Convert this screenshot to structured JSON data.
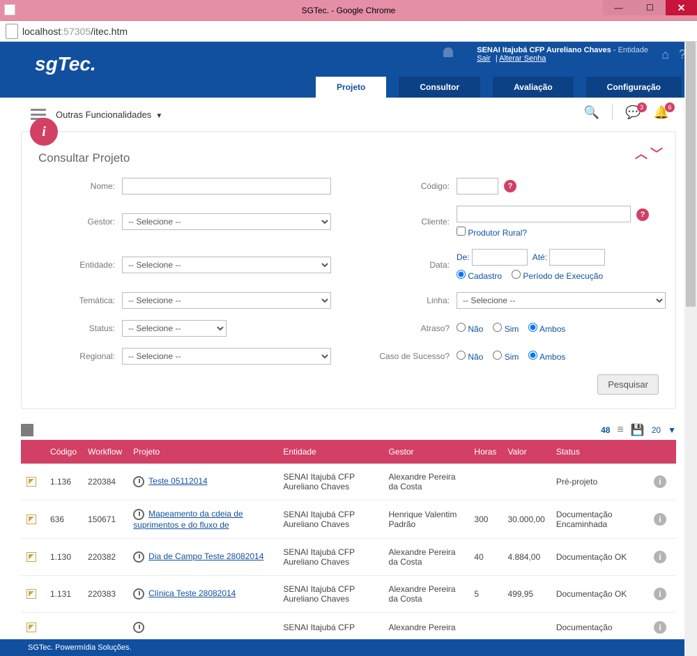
{
  "window": {
    "title": "SGTec. - Google Chrome"
  },
  "address": {
    "host": "localhost",
    "port": ":57305",
    "path": "/itec.htm"
  },
  "brand": "sgTec.",
  "user": {
    "name": "SENAI Itajubá CFP Aureliano Chaves",
    "role": "Entidade",
    "link_logout": "Sair",
    "link_pwd": "Alterar Senha"
  },
  "nav": [
    "Projeto",
    "Consultor",
    "Avaliação",
    "Configuração"
  ],
  "nav_active": 0,
  "toolbar": {
    "func_label": "Outras Funcionalidades",
    "badge_msg": "3",
    "badge_bell": "6"
  },
  "panel": {
    "title": "Consultar Projeto",
    "labels": {
      "nome": "Nome:",
      "codigo": "Código:",
      "gestor": "Gestor:",
      "cliente": "Cliente:",
      "produtor": "Produtor Rural?",
      "entidade": "Entidade:",
      "data": "Data:",
      "de": "De:",
      "ate": "Até:",
      "cadastro": "Cadastro",
      "periodo": "Período de Execução",
      "tematica": "Temática:",
      "linha": "Linha:",
      "status": "Status:",
      "atraso": "Atraso?",
      "regional": "Regional:",
      "caso": "Caso de Sucesso?",
      "nao": "Não",
      "sim": "Sim",
      "ambos": "Ambos"
    },
    "select_placeholder": "-- Selecione --",
    "search_btn": "Pesquisar"
  },
  "results": {
    "count": "48",
    "page_size": "20"
  },
  "columns": [
    "Código",
    "Workflow",
    "Projeto",
    "Entidade",
    "Gestor",
    "Horas",
    "Valor",
    "Status"
  ],
  "rows": [
    {
      "codigo": "1.136",
      "workflow": "220384",
      "projeto": "Teste 05112014",
      "entidade": "SENAI Itajubá CFP Aureliano Chaves",
      "gestor": "Alexandre Pereira da Costa",
      "horas": "",
      "valor": "",
      "status": "Pré-projeto"
    },
    {
      "codigo": "636",
      "workflow": "150671",
      "projeto": "Mapeamento da cdeia de suprimentos e do fluxo de",
      "entidade": "SENAI Itajubá CFP Aureliano Chaves",
      "gestor": "Henrique Valentim Padrão",
      "horas": "300",
      "valor": "30.000,00",
      "status": "Documentação Encaminhada"
    },
    {
      "codigo": "1.130",
      "workflow": "220382",
      "projeto": "Dia de Campo Teste 28082014",
      "entidade": "SENAI Itajubá CFP Aureliano Chaves",
      "gestor": "Alexandre Pereira da Costa",
      "horas": "40",
      "valor": "4.884,00",
      "status": "Documentação OK"
    },
    {
      "codigo": "1.131",
      "workflow": "220383",
      "projeto": "Clínica Teste 28082014",
      "entidade": "SENAI Itajubá CFP Aureliano Chaves",
      "gestor": "Alexandre Pereira da Costa",
      "horas": "5",
      "valor": "499,95",
      "status": "Documentação OK"
    },
    {
      "codigo": "",
      "workflow": "",
      "projeto": "",
      "entidade": "SENAI Itajubá CFP",
      "gestor": "Alexandre Pereira",
      "horas": "",
      "valor": "",
      "status": "Documentação"
    }
  ],
  "footer": "SGTec. Powermídia Soluções."
}
